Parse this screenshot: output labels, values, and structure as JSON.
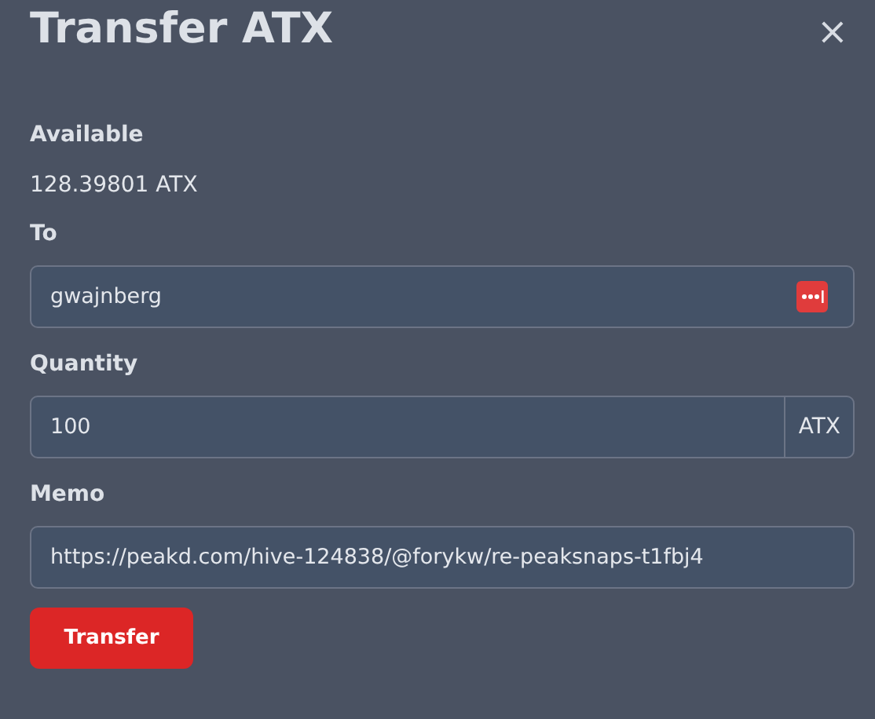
{
  "dialog": {
    "title": "Transfer ATX",
    "close": "×"
  },
  "available": {
    "label": "Available",
    "value": "128.39801 ATX"
  },
  "fields": [
    {
      "kind": "password-helper",
      "label": "To",
      "value": "gwajnberg"
    },
    {
      "kind": "suffix",
      "label": "Quantity",
      "value": "100",
      "suffix": "ATX"
    },
    {
      "kind": "plain",
      "label": "Memo",
      "value": "https://peakd.com/hive-124838/@forykw/re-peaksnaps-t1fbj4"
    }
  ],
  "button": "Transfer"
}
